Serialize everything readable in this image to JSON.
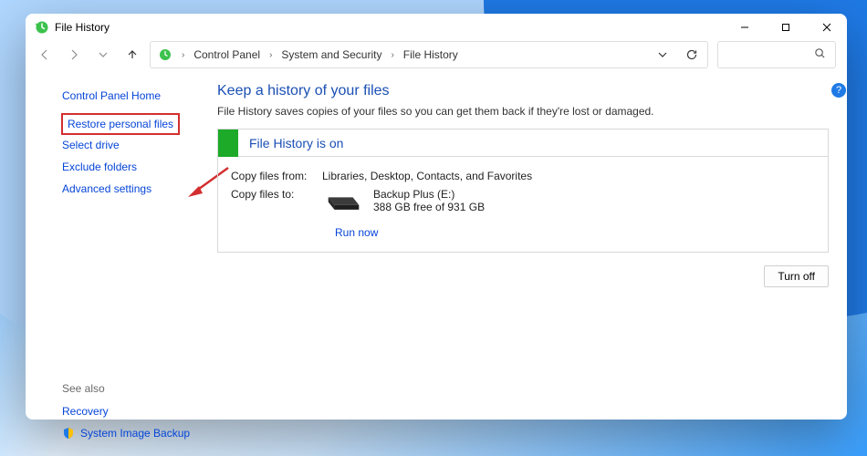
{
  "window": {
    "title": "File History"
  },
  "breadcrumbs": [
    "Control Panel",
    "System and Security",
    "File History"
  ],
  "search": {
    "placeholder": ""
  },
  "sidebar": {
    "home": "Control Panel Home",
    "links": [
      "Restore personal files",
      "Select drive",
      "Exclude folders",
      "Advanced settings"
    ],
    "see_also_label": "See also",
    "see_also": [
      "Recovery",
      "System Image Backup"
    ]
  },
  "main": {
    "heading": "Keep a history of your files",
    "subhead": "File History saves copies of your files so you can get them back if they're lost or damaged.",
    "panel_title": "File History is on",
    "copy_from_label": "Copy files from:",
    "copy_from_value": "Libraries, Desktop, Contacts, and Favorites",
    "copy_to_label": "Copy files to:",
    "drive_name": "Backup Plus (E:)",
    "drive_free": "388 GB free of 931 GB",
    "run_now": "Run now",
    "turn_off": "Turn off"
  },
  "help": "?"
}
